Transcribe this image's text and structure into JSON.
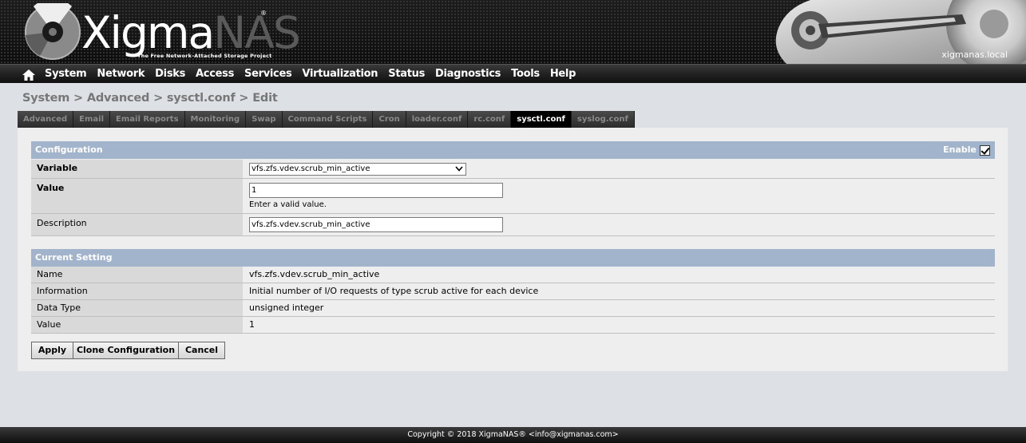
{
  "header": {
    "logo_main": "Xigma",
    "logo_accent": "NAS",
    "logo_tagline": "The Free Network-Attached Storage Project",
    "hostname": "xigmanas.local"
  },
  "nav": {
    "items": [
      "System",
      "Network",
      "Disks",
      "Access",
      "Services",
      "Virtualization",
      "Status",
      "Diagnostics",
      "Tools",
      "Help"
    ]
  },
  "breadcrumb": "System > Advanced > sysctl.conf > Edit",
  "tabs": [
    "Advanced",
    "Email",
    "Email Reports",
    "Monitoring",
    "Swap",
    "Command Scripts",
    "Cron",
    "loader.conf",
    "rc.conf",
    "sysctl.conf",
    "syslog.conf"
  ],
  "active_tab": "sysctl.conf",
  "configuration": {
    "title": "Configuration",
    "enable_label": "Enable",
    "enabled": true,
    "variable_label": "Variable",
    "variable_value": "vfs.zfs.vdev.scrub_min_active",
    "value_label": "Value",
    "value_value": "1",
    "value_hint": "Enter a valid value.",
    "description_label": "Description",
    "description_value": "vfs.zfs.vdev.scrub_min_active"
  },
  "current_setting": {
    "title": "Current Setting",
    "rows": [
      {
        "label": "Name",
        "value": "vfs.zfs.vdev.scrub_min_active"
      },
      {
        "label": "Information",
        "value": "Initial number of I/O requests of type scrub active for each device"
      },
      {
        "label": "Data Type",
        "value": "unsigned integer"
      },
      {
        "label": "Value",
        "value": "1"
      }
    ]
  },
  "buttons": {
    "apply": "Apply",
    "clone": "Clone Configuration",
    "cancel": "Cancel"
  },
  "footer": "Copyright © 2018 XigmaNAS® <info@xigmanas.com>",
  "colors": {
    "section_header": "#a2b3cc",
    "page_bg": "#dde1e6",
    "panel_bg": "#eeeeee"
  }
}
